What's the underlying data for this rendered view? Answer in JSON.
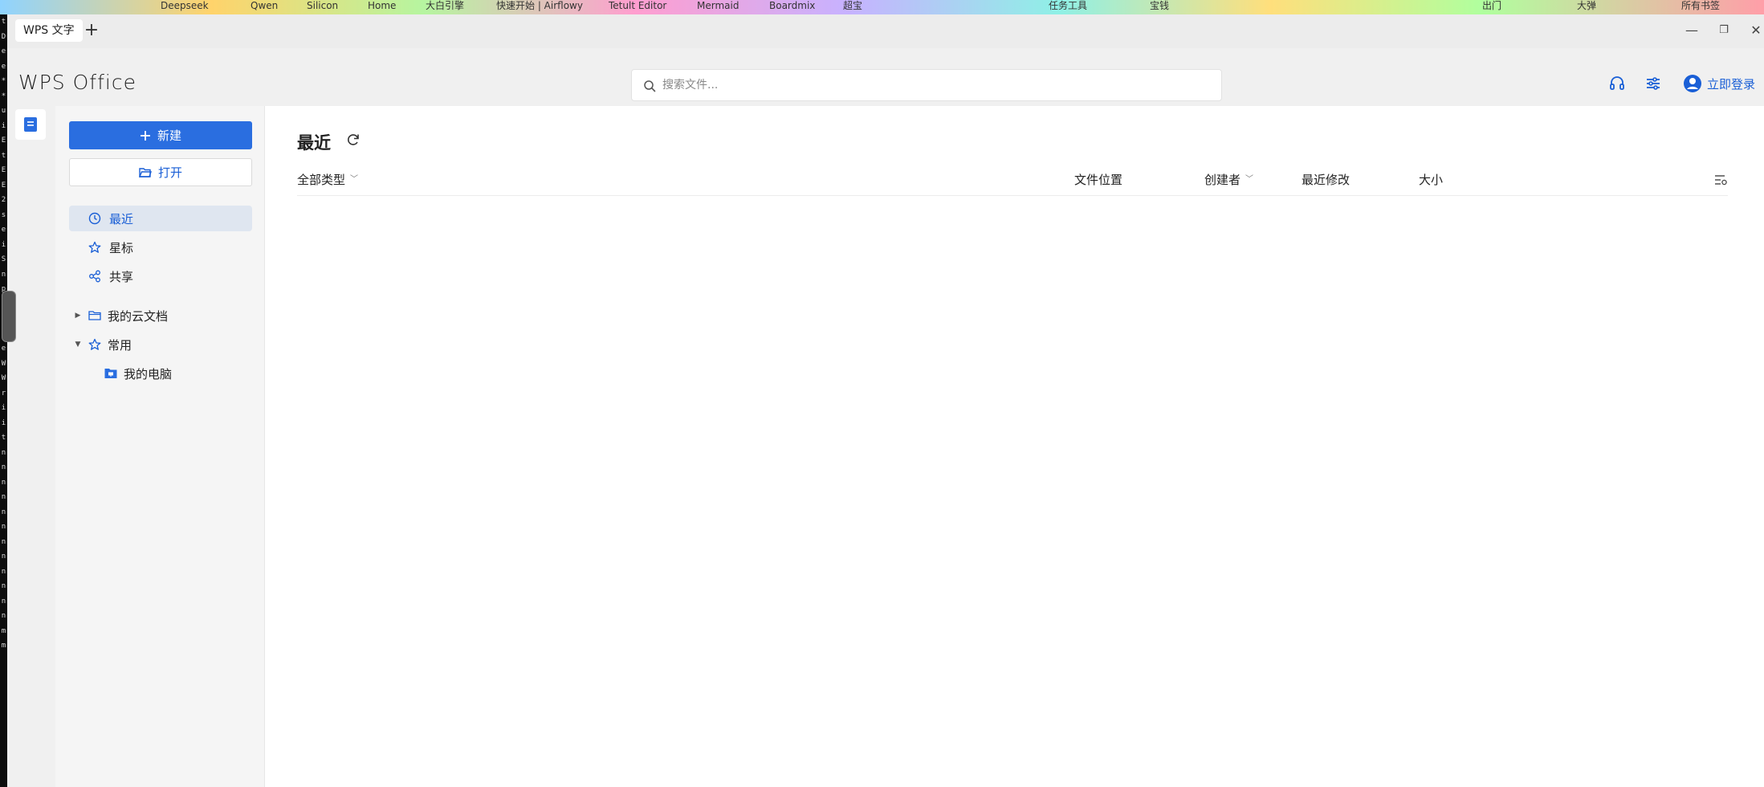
{
  "bookmarks": [
    "Deepseek",
    "Qwen",
    "Silicon",
    "Home",
    "大白引擎",
    "快速开始 | Airflowy",
    "Tetult Editor",
    "Mermaid",
    "Boardmix",
    "超宝",
    "任务工具",
    "宝钱",
    "出门",
    "大弹",
    "所有书签"
  ],
  "terminal_chars": [
    "t",
    "D",
    "e",
    "e",
    "*",
    "*",
    "u",
    "i",
    "E",
    "t",
    "E",
    "E",
    "2",
    "s",
    "e",
    "i",
    "S",
    "n",
    "p",
    "e",
    "d",
    "i",
    "e",
    "W",
    "W",
    "r",
    "i",
    "i",
    "t",
    "n",
    "n",
    "n",
    "n",
    "n",
    "n",
    "n",
    "n",
    "n",
    "n",
    "n",
    "n",
    "m",
    "m"
  ],
  "tabbar": {
    "tab_label": "WPS 文字",
    "add_symbol": "+",
    "min_symbol": "—",
    "max_symbol": "❐",
    "close_symbol": "✕"
  },
  "header": {
    "logo": "WPS Office",
    "search_placeholder": "搜索文件...",
    "login_label": "立即登录",
    "icons": [
      "headset-icon",
      "sliders-icon",
      "user-avatar-icon",
      "search-icon"
    ]
  },
  "sidebar": {
    "new_label": "新建",
    "open_label": "打开",
    "nav": [
      {
        "label": "最近",
        "icon": "clock-icon",
        "active": true
      },
      {
        "label": "星标",
        "icon": "star-icon",
        "active": false
      },
      {
        "label": "共享",
        "icon": "share-icon",
        "active": false
      }
    ],
    "tree": [
      {
        "label": "我的云文档",
        "icon": "folder-icon",
        "caret": "▶"
      },
      {
        "label": "常用",
        "icon": "pin-icon",
        "caret": "▼"
      },
      {
        "label": "我的电脑",
        "icon": "computer-folder-icon"
      }
    ]
  },
  "main": {
    "title": "最近",
    "columns": [
      {
        "id": "type",
        "label": "全部类型",
        "dropdown": true
      },
      {
        "id": "location",
        "label": "文件位置",
        "dropdown": false
      },
      {
        "id": "creator",
        "label": "创建者",
        "dropdown": true
      },
      {
        "id": "modified",
        "label": "最近修改",
        "dropdown": false
      },
      {
        "id": "size",
        "label": "大小",
        "dropdown": false
      }
    ]
  },
  "colors": {
    "accent": "#2a6ee0",
    "link": "#1a5fd6",
    "active_bg": "#dfe6f0"
  }
}
